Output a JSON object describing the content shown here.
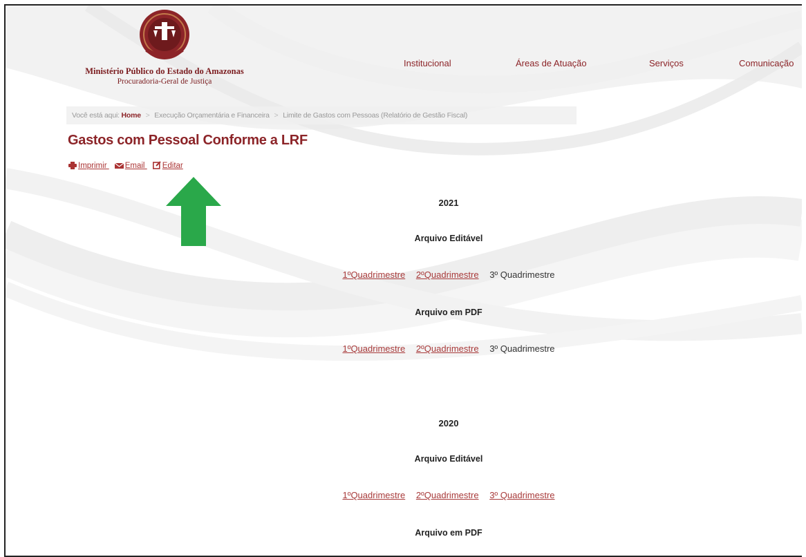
{
  "header": {
    "org_name": "Ministério Público do Estado do Amazonas",
    "org_sub": "Procuradoria-Geral de Justiça",
    "nav": [
      "Institucional",
      "Áreas de Atuação",
      "Serviços",
      "Comunicação"
    ]
  },
  "breadcrumb": {
    "prefix": "Você está aqui:",
    "items": [
      "Home",
      "Execução Orçamentária e Financeira",
      "Limite de Gastos com Pessoas (Relatório de Gestão Fiscal)"
    ]
  },
  "page": {
    "title": "Gastos com Pessoal Conforme a LRF",
    "actions": [
      "Imprimir",
      "Email",
      "Editar"
    ]
  },
  "sections": [
    {
      "year": "2021",
      "groups": [
        {
          "label": "Arquivo Editável",
          "items": [
            {
              "text": "1ºQuadrimestre",
              "link": true
            },
            {
              "text": "2ºQuadrimestre",
              "link": true
            },
            {
              "text": "3º Quadrimestre",
              "link": false
            }
          ]
        },
        {
          "label": "Arquivo em PDF",
          "items": [
            {
              "text": "1ºQuadrimestre",
              "link": true
            },
            {
              "text": "2ºQuadrimestre",
              "link": true
            },
            {
              "text": "3º Quadrimestre",
              "link": false
            }
          ]
        }
      ]
    },
    {
      "year": "2020",
      "groups": [
        {
          "label": "Arquivo Editável",
          "items": [
            {
              "text": "1ºQuadrimestre",
              "link": true
            },
            {
              "text": "2ºQuadrimestre",
              "link": true
            },
            {
              "text": "3º Quadrimestre",
              "link": true
            }
          ]
        },
        {
          "label": "Arquivo em PDF",
          "items": []
        }
      ]
    }
  ],
  "colors": {
    "brand": "#8c2428",
    "link": "#a83a3a",
    "arrow": "#2aa84a"
  }
}
